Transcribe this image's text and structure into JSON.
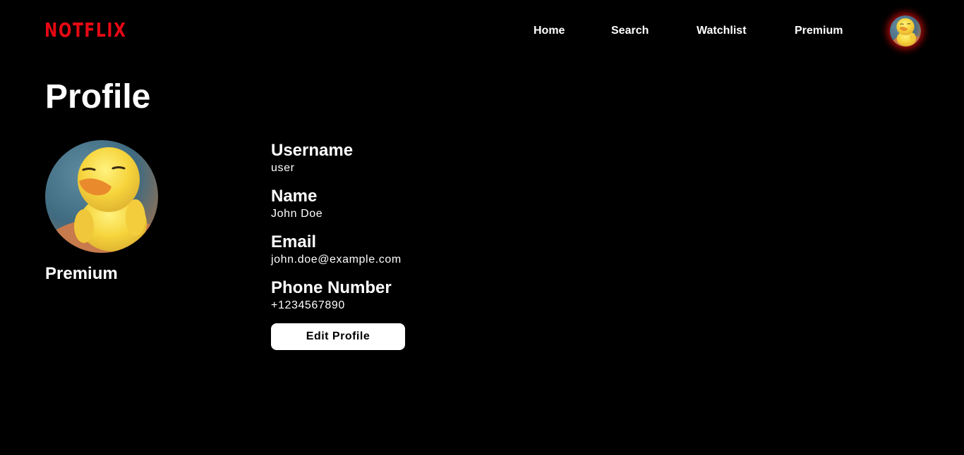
{
  "brand": {
    "logo_text": "NOTFLIX",
    "accent_color": "#e50914"
  },
  "nav": {
    "items": [
      {
        "label": "Home"
      },
      {
        "label": "Search"
      },
      {
        "label": "Watchlist"
      },
      {
        "label": "Premium"
      }
    ],
    "avatar_icon": "duck-avatar-icon"
  },
  "page": {
    "title": "Profile"
  },
  "profile": {
    "avatar_icon": "duck-avatar-icon",
    "tier": "Premium",
    "fields": [
      {
        "label": "Username",
        "value": "user"
      },
      {
        "label": "Name",
        "value": "John Doe"
      },
      {
        "label": "Email",
        "value": "john.doe@example.com"
      },
      {
        "label": "Phone Number",
        "value": "+1234567890"
      }
    ],
    "edit_label": "Edit Profile"
  },
  "colors": {
    "background": "#000000",
    "text": "#ffffff",
    "button_bg": "#ffffff",
    "button_text": "#000000",
    "avatar_glow": "#c80a0a"
  }
}
